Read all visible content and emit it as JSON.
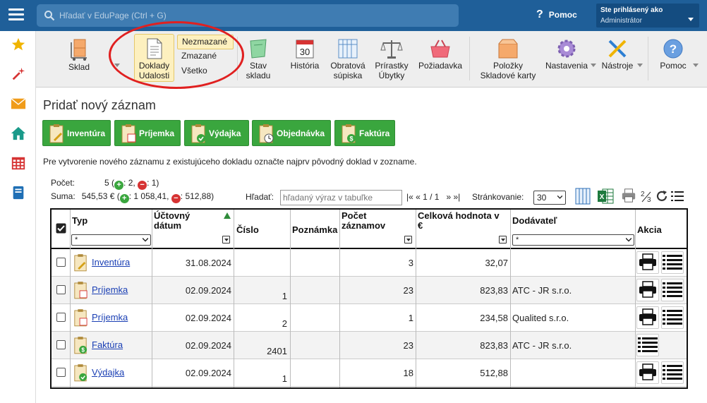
{
  "topbar": {
    "search_placeholder": "Hľadať v EduPage (Ctrl + G)",
    "help_label": "Pomoc",
    "help_glyph": "?",
    "user_line1": "Ste prihlásený ako",
    "user_line2": "Administrátor"
  },
  "sidebar": {
    "items": [
      {
        "icon": "star-icon",
        "color": "#f0b400"
      },
      {
        "icon": "magic-wand-icon",
        "color": "#d63333"
      },
      {
        "icon": "mail-icon",
        "color": "#f09c1a"
      },
      {
        "icon": "home-icon",
        "color": "#1a9a8a"
      },
      {
        "icon": "timetable-icon",
        "color": "#d63333"
      },
      {
        "icon": "book-icon",
        "color": "#1f6fb5"
      }
    ]
  },
  "toolbar": {
    "sklad": "Sklad",
    "doklady_line1": "Doklady",
    "doklady_line2": "Udalosti",
    "dropdown": [
      "Nezmazané",
      "Zmazané",
      "Všetko"
    ],
    "stav_line1": "Stav",
    "stav_line2": "skladu",
    "historia": "História",
    "historia_day": "30",
    "obratova_line1": "Obratová",
    "obratova_line2": "súpiska",
    "prirastky_line1": "Prírastky",
    "prirastky_line2": "Úbytky",
    "poziadavka": "Požiadavka",
    "polozky_line1": "Položky",
    "polozky_line2": "Skladové karty",
    "nastavenia": "Nastavenia",
    "nastroje": "Nástroje",
    "pomoc": "Pomoc"
  },
  "content": {
    "title": "Pridať nový záznam",
    "buttons": [
      "Inventúra",
      "Príjemka",
      "Výdajka",
      "Objednávka",
      "Faktúra"
    ],
    "hint": "Pre vytvorenie nového záznamu z existujúceho dokladu označte najprv pôvodný doklad v zozname."
  },
  "stats": {
    "count_label": "Počet:",
    "count_total": "5 (",
    "count_plus": ": 2, ",
    "count_minus": ": 1)",
    "sum_label": "Suma:",
    "sum_total": "545,53 € (",
    "sum_plus": ": 1 058,41, ",
    "sum_minus": ": 512,88)",
    "plus_glyph": "+",
    "minus_glyph": "−"
  },
  "filterbar": {
    "find_label": "Hľadať:",
    "find_placeholder": "hľadaný výraz v tabuľke",
    "pager": "|« « 1 / 1   » »|",
    "pagesize_label": "Stránkovanie:",
    "pagesize_value": "30"
  },
  "table": {
    "headers": {
      "typ": "Typ",
      "datum_line1": "Účtovný",
      "datum_line2": "dátum",
      "cislo": "Číslo",
      "poznamka": "Poznámka",
      "pocet_line1": "Počet",
      "pocet_line2": "záznamov",
      "hodnota_line1": "Celková hodnota v",
      "hodnota_line2": "€",
      "dodavatel": "Dodávateľ",
      "akcia": "Akcia"
    },
    "typ_filter": "*",
    "dodavatel_filter": "*",
    "rows": [
      {
        "typ": "Inventúra",
        "datum": "31.08.2024",
        "cislo": "",
        "poznamka": "",
        "pocet": "3",
        "hodnota": "32,07",
        "dodavatel": "",
        "print": true
      },
      {
        "typ": "Príjemka",
        "datum": "02.09.2024",
        "cislo": "1",
        "poznamka": "",
        "pocet": "23",
        "hodnota": "823,83",
        "dodavatel": "ATC - JR s.r.o.",
        "print": true
      },
      {
        "typ": "Príjemka",
        "datum": "02.09.2024",
        "cislo": "2",
        "poznamka": "",
        "pocet": "1",
        "hodnota": "234,58",
        "dodavatel": "Qualited s.r.o.",
        "print": true
      },
      {
        "typ": "Faktúra",
        "datum": "02.09.2024",
        "cislo": "2401",
        "poznamka": "",
        "pocet": "23",
        "hodnota": "823,83",
        "dodavatel": "ATC - JR s.r.o.",
        "print": false
      },
      {
        "typ": "Výdajka",
        "datum": "02.09.2024",
        "cislo": "1",
        "poznamka": "",
        "pocet": "18",
        "hodnota": "512,88",
        "dodavatel": "",
        "print": true
      }
    ]
  }
}
